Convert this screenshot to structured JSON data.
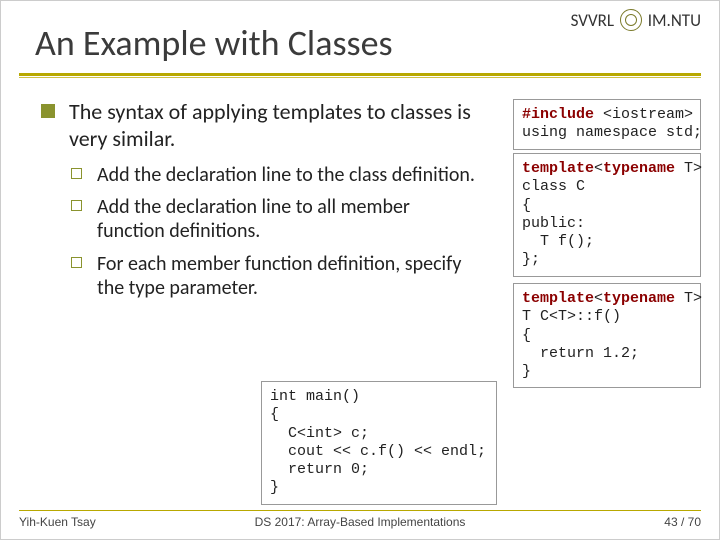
{
  "header": {
    "org_left": "SVVRL",
    "org_right": "IM.NTU",
    "title": "An Example with Classes"
  },
  "bullets": {
    "main": "The syntax of applying templates to classes is very similar.",
    "sub": [
      "Add the declaration line to the class definition.",
      "Add the declaration line to all member function definitions.",
      "For each member function definition, specify the type parameter."
    ]
  },
  "code": {
    "includes": {
      "l1a": "#include",
      "l1b": " <iostream>",
      "l2": "using namespace std;"
    },
    "classdef": {
      "l1a": "template",
      "l1b": "<",
      "l1c": "typename",
      "l1d": " T>",
      "l2": "class C",
      "l3": "{",
      "l4": "public:",
      "l5": "  T f();",
      "l6": "};"
    },
    "funcdef": {
      "l1a": "template",
      "l1b": "<",
      "l1c": "typename",
      "l1d": " T>",
      "l2": "T C<T>::f()",
      "l3": "{",
      "l4": "  return 1.2;",
      "l5": "}"
    },
    "main": {
      "l1": "int main()",
      "l2": "{",
      "l3": "  C<int> c;",
      "l4": "  cout << c.f() << endl;",
      "l5": "  return 0;",
      "l6": "}"
    }
  },
  "footer": {
    "author": "Yih-Kuen Tsay",
    "course": "DS 2017: Array-Based Implementations",
    "page": "43 / 70"
  }
}
